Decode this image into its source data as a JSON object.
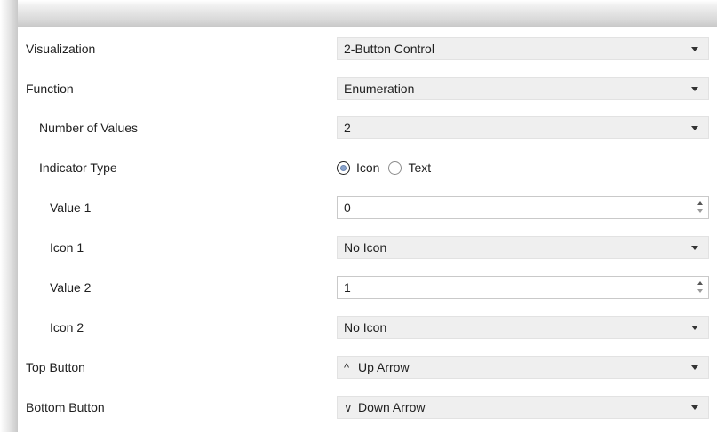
{
  "rows": {
    "visualization": {
      "label": "Visualization",
      "value": "2-Button Control"
    },
    "function": {
      "label": "Function",
      "value": "Enumeration"
    },
    "num_values": {
      "label": "Number of Values",
      "value": "2"
    },
    "indicator_type": {
      "label": "Indicator Type",
      "options": [
        "Icon",
        "Text"
      ],
      "selected": "Icon"
    },
    "value1": {
      "label": "Value 1",
      "value": "0"
    },
    "icon1": {
      "label": "Icon 1",
      "value": "No Icon"
    },
    "value2": {
      "label": "Value 2",
      "value": "1"
    },
    "icon2": {
      "label": "Icon 2",
      "value": "No Icon"
    },
    "top_button": {
      "label": "Top Button",
      "glyph": "^",
      "value": "Up Arrow"
    },
    "bottom_button": {
      "label": "Bottom Button",
      "glyph": "∨",
      "value": "Down Arrow"
    }
  },
  "colors": {
    "dropdown_bg": "#efefef",
    "radio_selected_fill": "#8aa4cc"
  },
  "icons": {
    "dropdown": "caret-down-icon",
    "stepper": "spinner-arrows-icon",
    "top_button": "chevron-up-icon",
    "bottom_button": "chevron-down-icon"
  }
}
